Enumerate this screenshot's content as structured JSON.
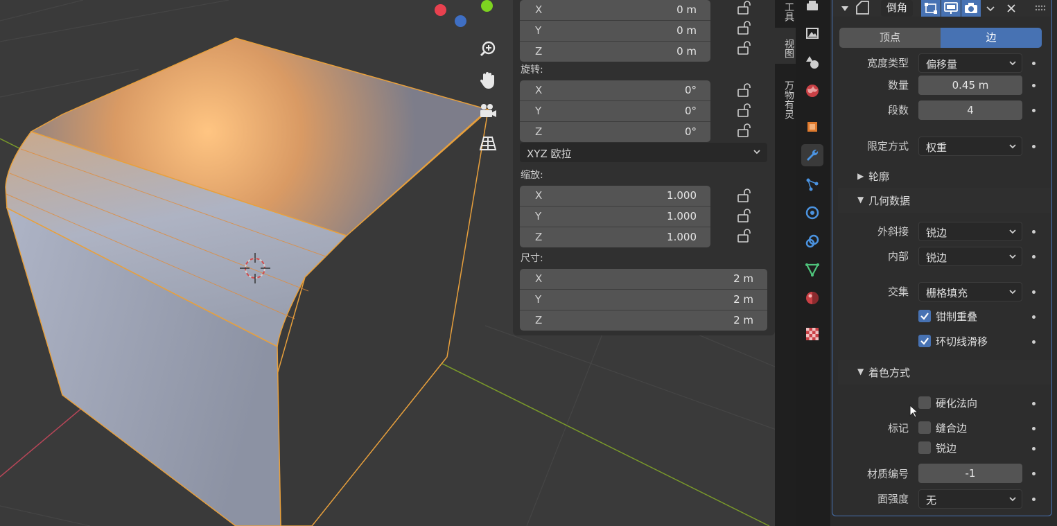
{
  "navigation": {
    "zoom_icon": "zoom-in-icon",
    "pan_icon": "hand-icon",
    "camera_icon": "camera-icon",
    "grid_icon": "ortho-grid-icon"
  },
  "transform": {
    "location": {
      "x": "0 m",
      "y": "0 m",
      "z": "0 m"
    },
    "rotation_label": "旋转:",
    "rotation": {
      "x": "0°",
      "y": "0°",
      "z": "0°"
    },
    "rotation_mode": "XYZ 欧拉",
    "scale_label": "缩放:",
    "scale": {
      "x": "1.000",
      "y": "1.000",
      "z": "1.000"
    },
    "dimensions_label": "尺寸:",
    "dimensions": {
      "x": "2 m",
      "y": "2 m",
      "z": "2 m"
    },
    "axis": {
      "x": "X",
      "y": "Y",
      "z": "Z"
    }
  },
  "sidebar_tabs": {
    "tool": "工具",
    "view": "视图",
    "addon": "万物有灵"
  },
  "modifier": {
    "name": "倒角",
    "affect_vertices": "顶点",
    "affect_edges": "边",
    "width_type_label": "宽度类型",
    "width_type": "偏移量",
    "amount_label": "数量",
    "amount": "0.45 m",
    "segments_label": "段数",
    "segments": "4",
    "limit_method_label": "限定方式",
    "limit_method": "权重",
    "profile_label": "轮廓",
    "geometry_label": "几何数据",
    "miter_outer_label": "外斜接",
    "miter_outer": "锐边",
    "miter_inner_label": "内部",
    "miter_inner": "锐边",
    "intersection_label": "交集",
    "intersection": "栅格填充",
    "clamp_overlap": "钳制重叠",
    "loop_slide": "环切线滑移",
    "shading_label": "着色方式",
    "harden_normals": "硬化法向",
    "mark_label": "标记",
    "mark_seam": "缝合边",
    "mark_sharp": "锐边",
    "material_index_label": "材质编号",
    "material_index": "-1",
    "face_strength_label": "面强度",
    "face_strength": "无"
  },
  "colors": {
    "accent": "#4772b3",
    "selection_orange": "#e8a03c",
    "gizmo_x": "#e8414f",
    "gizmo_y": "#7dd320",
    "gizmo_z": "#3f6fc4"
  }
}
